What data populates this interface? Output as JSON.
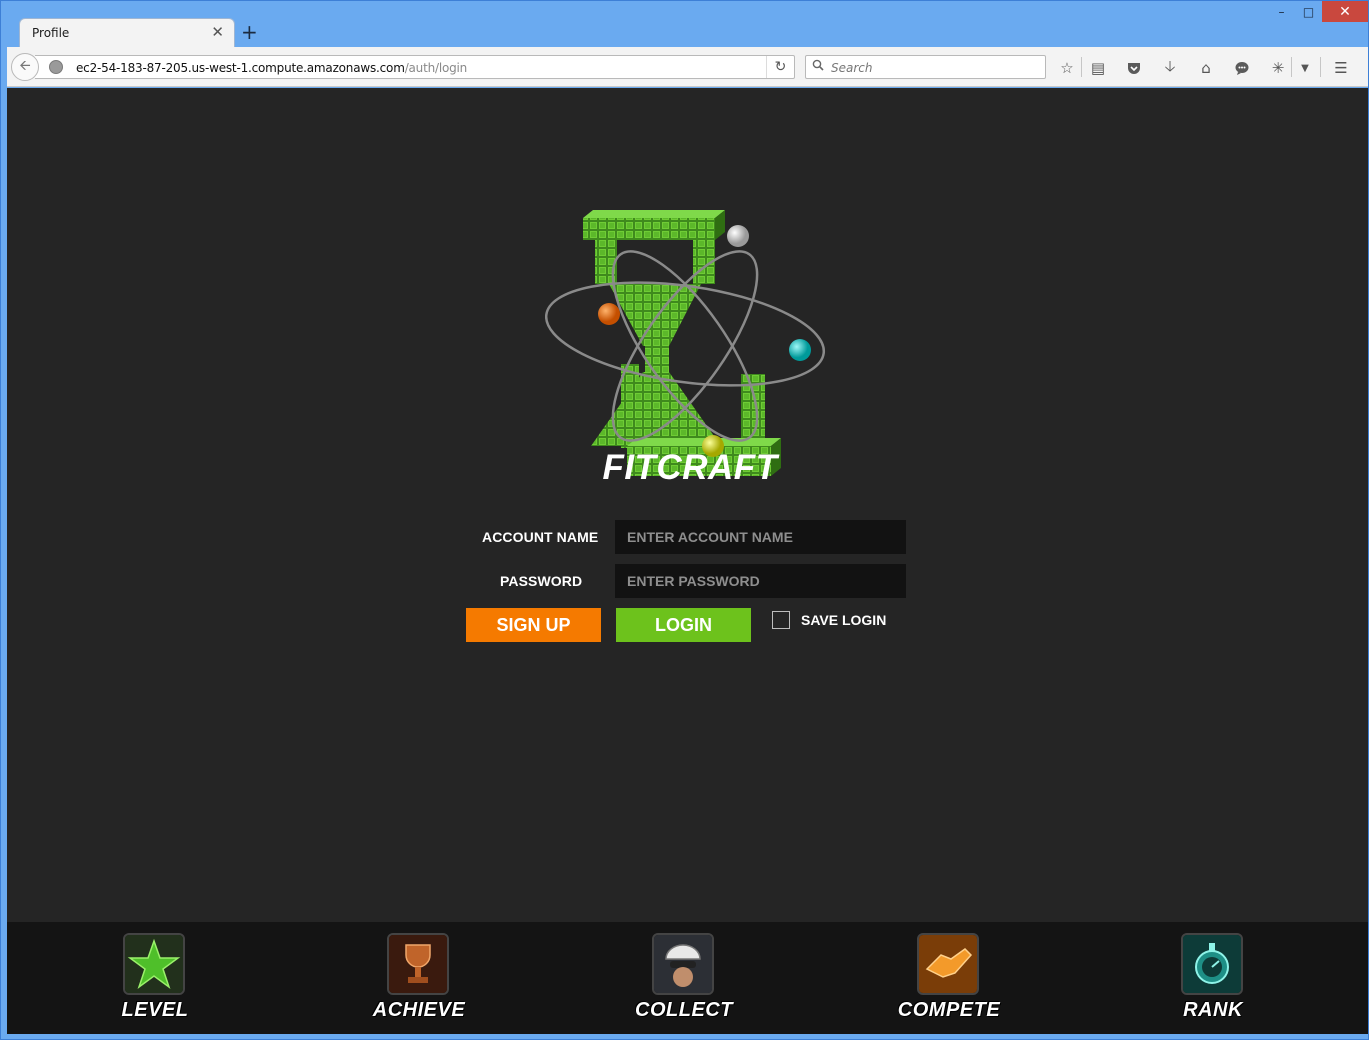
{
  "browser": {
    "tab_title": "Profile",
    "url_host": "ec2-54-183-87-205.us-west-1.compute.amazonaws.com",
    "url_path": "/auth/login",
    "search_placeholder": "Search"
  },
  "brand": {
    "name": "FITCRAFT",
    "colors": {
      "green": "#5cb82a",
      "orange": "#f57a00",
      "background": "#252525"
    }
  },
  "login_form": {
    "account_label": "ACCOUNT NAME",
    "account_placeholder": "ENTER ACCOUNT NAME",
    "password_label": "PASSWORD",
    "password_placeholder": "ENTER PASSWORD",
    "signup_label": "SIGN UP",
    "login_label": "LOGIN",
    "save_login_label": "SAVE LOGIN",
    "save_login_checked": false
  },
  "footer_nav": [
    {
      "label": "LEVEL",
      "icon": "star-icon"
    },
    {
      "label": "ACHIEVE",
      "icon": "trophy-icon"
    },
    {
      "label": "COLLECT",
      "icon": "cyclist-icon"
    },
    {
      "label": "COMPETE",
      "icon": "handshake-icon"
    },
    {
      "label": "RANK",
      "icon": "stopwatch-icon"
    }
  ]
}
